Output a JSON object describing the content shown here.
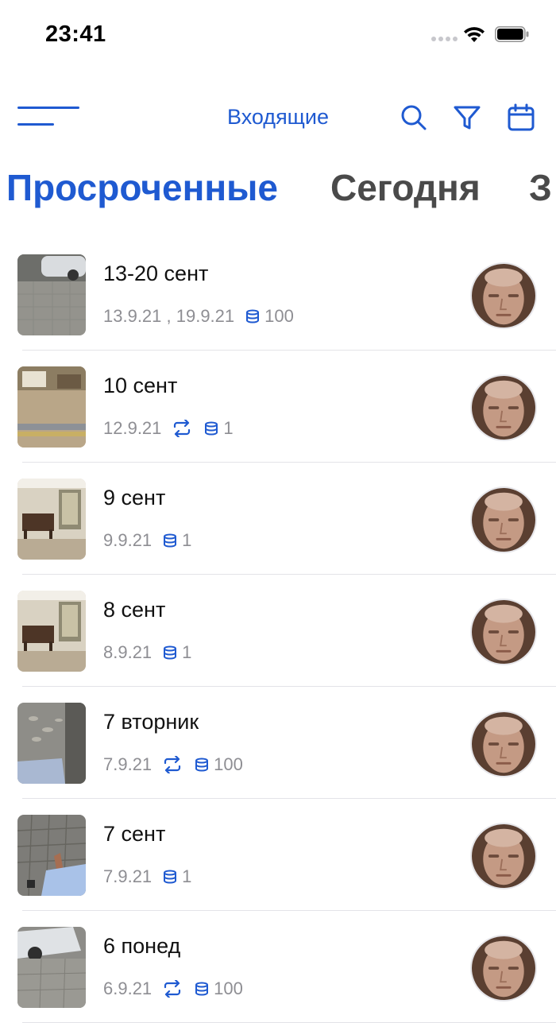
{
  "status_bar": {
    "time": "23:41"
  },
  "header": {
    "title": "Входящие",
    "icons": [
      "menu-icon",
      "search-icon",
      "filter-icon",
      "calendar-icon"
    ]
  },
  "tabs": [
    {
      "label": "Просроченные",
      "active": true
    },
    {
      "label": "Сегодня",
      "active": false
    },
    {
      "label": "З",
      "active": false
    }
  ],
  "colors": {
    "accent": "#1f5ad1",
    "meta_text": "#8e8e93",
    "inactive_tab": "#4a4a4a"
  },
  "items": [
    {
      "title": "13-20 сент",
      "date": "13.9.21 , 19.9.21",
      "repeat": false,
      "count": "100",
      "thumb": "parking-pavement"
    },
    {
      "title": "10 сент",
      "date": "12.9.21",
      "repeat": true,
      "count": "1",
      "thumb": "room-floor"
    },
    {
      "title": "9 сент",
      "date": "9.9.21",
      "repeat": false,
      "count": "1",
      "thumb": "dining-room"
    },
    {
      "title": "8 сент",
      "date": "8.9.21",
      "repeat": false,
      "count": "1",
      "thumb": "dining-room"
    },
    {
      "title": "7 вторник",
      "date": "7.9.21",
      "repeat": true,
      "count": "100",
      "thumb": "pavement-shadow"
    },
    {
      "title": "7 сент",
      "date": "7.9.21",
      "repeat": false,
      "count": "1",
      "thumb": "pavement-leg"
    },
    {
      "title": "6 понед",
      "date": "6.9.21",
      "repeat": true,
      "count": "100",
      "thumb": "car-parking"
    }
  ]
}
